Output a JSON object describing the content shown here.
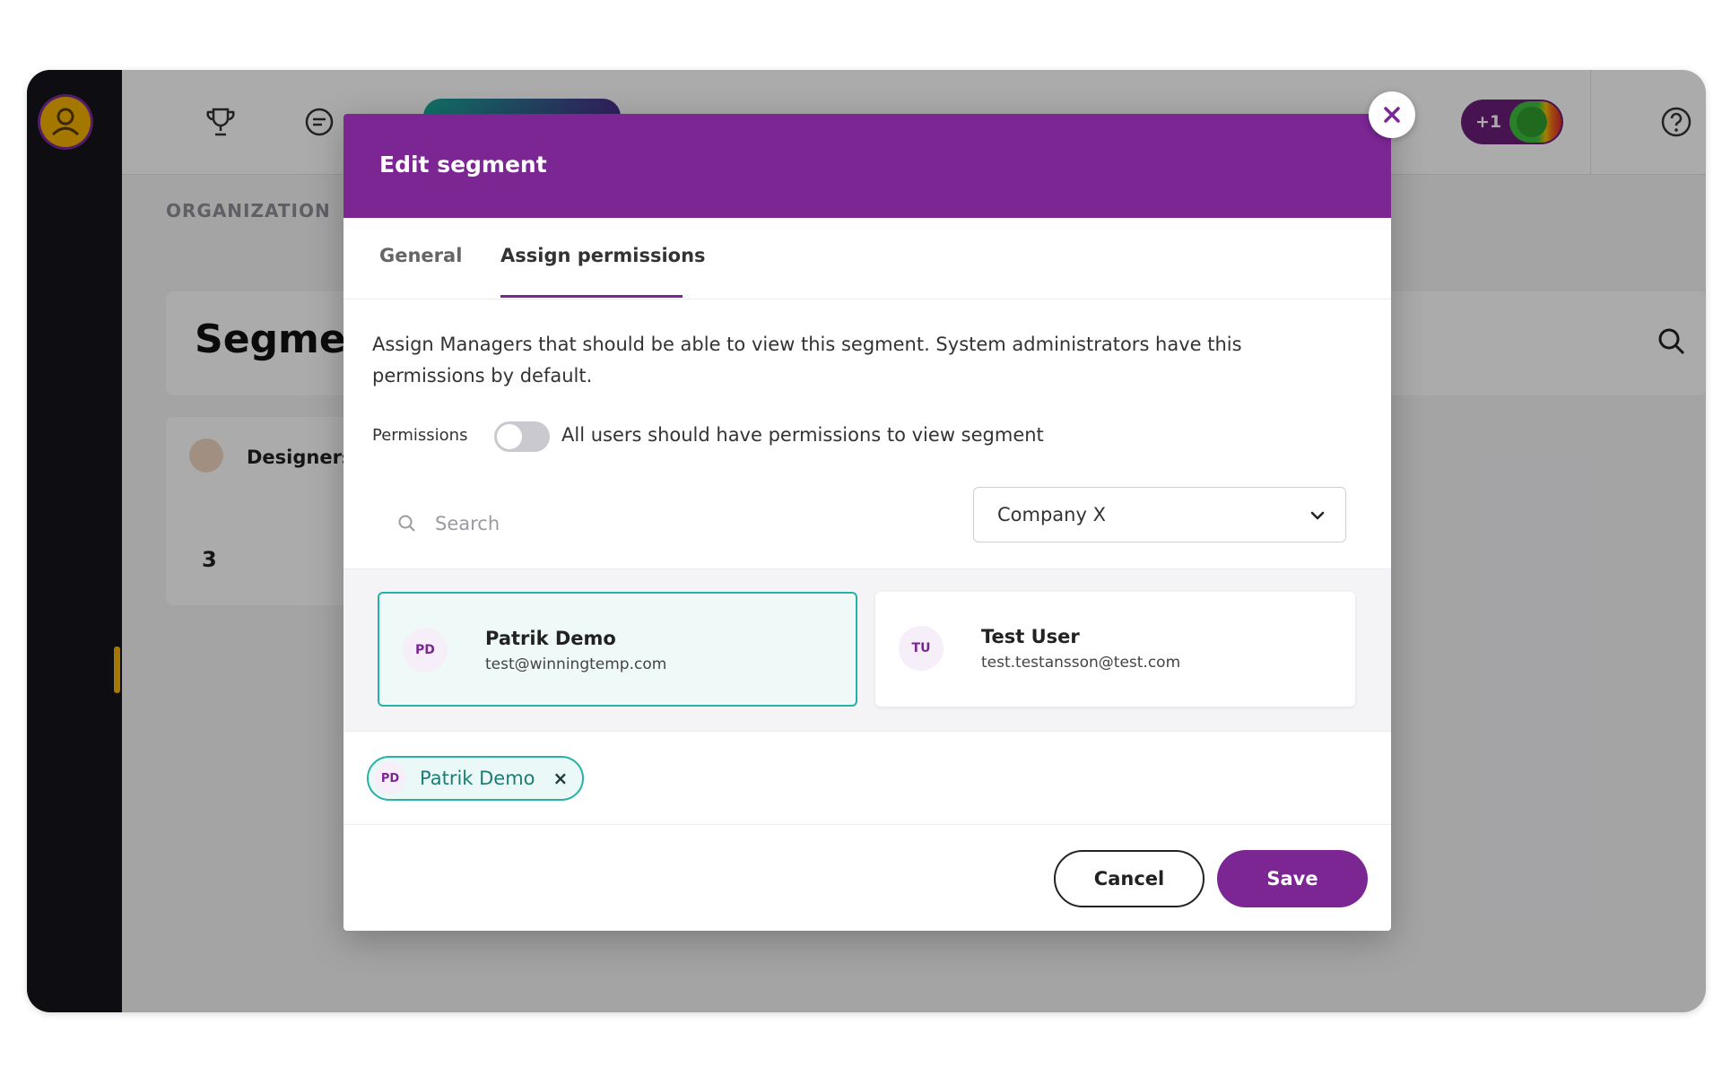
{
  "background": {
    "breadcrumb": "ORGANIZATION",
    "page_title": "Segmer",
    "segment_card": {
      "name": "Designers",
      "count": "3"
    },
    "badge": "+1"
  },
  "modal": {
    "title": "Edit segment",
    "tabs": [
      {
        "label": "General",
        "active": false
      },
      {
        "label": "Assign permissions",
        "active": true
      }
    ],
    "description": "Assign Managers that should be able to view this segment. System administrators have this permissions by default.",
    "permissions_label": "Permissions",
    "toggle": {
      "label": "All users should have permissions to view segment",
      "on": false
    },
    "search": {
      "placeholder": "Search",
      "value": ""
    },
    "company_select": {
      "value": "Company X"
    },
    "users": [
      {
        "initials": "PD",
        "name": "Patrik Demo",
        "email": "test@winningtemp.com",
        "selected": true
      },
      {
        "initials": "TU",
        "name": "Test User",
        "email": "test.testansson@test.com",
        "selected": false
      }
    ],
    "selected_chips": [
      {
        "initials": "PD",
        "name": "Patrik Demo",
        "remove": "×"
      }
    ],
    "cancel_label": "Cancel",
    "save_label": "Save"
  },
  "colors": {
    "brand_purple": "#7b2693",
    "accent_teal": "#26b0a7",
    "sidebar": "#15141a"
  },
  "icons": [
    "user-avatar-icon",
    "trophy-icon",
    "chat-icon",
    "help-icon",
    "search-icon",
    "close-icon",
    "chevron-down-icon",
    "list-icon",
    "person-icon"
  ]
}
